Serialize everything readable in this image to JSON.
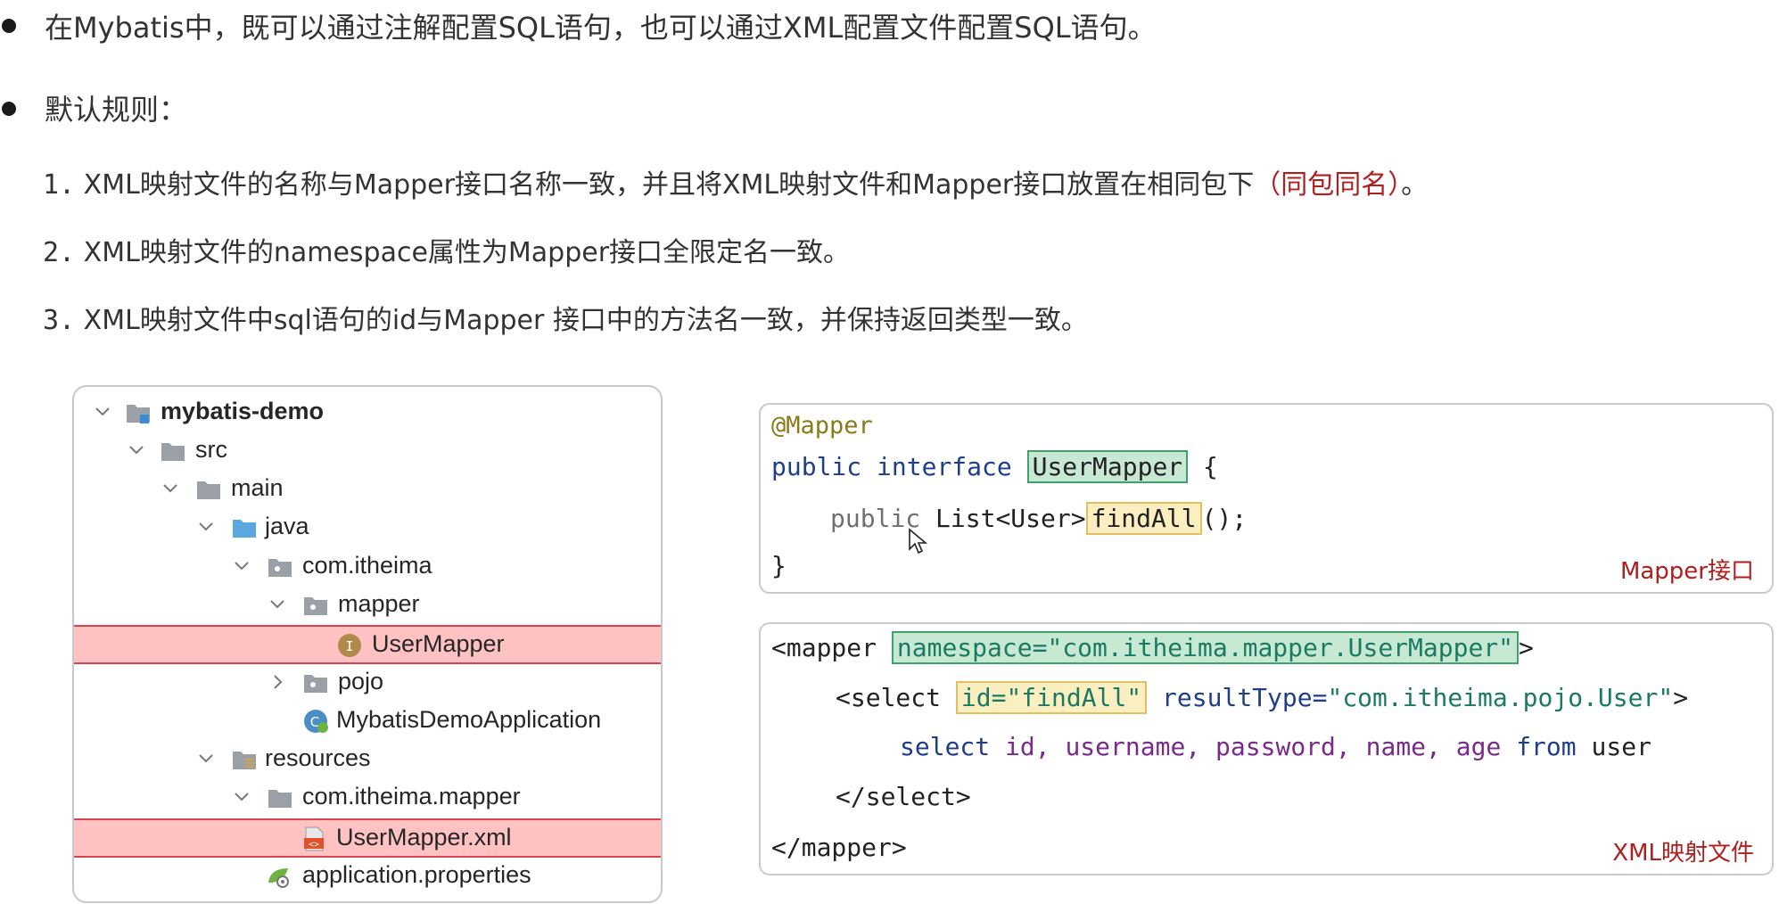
{
  "intro": {
    "line1": "在Mybatis中，既可以通过注解配置SQL语句，也可以通过XML配置文件配置SQL语句。",
    "line2": "默认规则："
  },
  "rules": [
    {
      "num": "1.",
      "text": "XML映射文件的名称与Mapper接口名称一致，并且将XML映射文件和Mapper接口放置在相同包下",
      "highlight": "（同包同名）",
      "tail": "。"
    },
    {
      "num": "2.",
      "text": "XML映射文件的namespace属性为Mapper接口全限定名一致。"
    },
    {
      "num": "3.",
      "text": "XML映射文件中sql语句的id与Mapper 接口中的方法名一致，并保持返回类型一致。"
    }
  ],
  "tree": {
    "items": [
      {
        "label": "mybatis-demo",
        "icon": "module-folder-icon"
      },
      {
        "label": "src",
        "icon": "folder-icon"
      },
      {
        "label": "main",
        "icon": "folder-icon"
      },
      {
        "label": "java",
        "icon": "source-folder-icon"
      },
      {
        "label": "com.itheima",
        "icon": "package-icon"
      },
      {
        "label": "mapper",
        "icon": "package-icon"
      },
      {
        "label": "UserMapper",
        "icon": "interface-icon"
      },
      {
        "label": "pojo",
        "icon": "package-icon"
      },
      {
        "label": "MybatisDemoApplication",
        "icon": "spring-class-icon"
      },
      {
        "label": "resources",
        "icon": "resources-folder-icon"
      },
      {
        "label": "com.itheima.mapper",
        "icon": "folder-icon"
      },
      {
        "label": "UserMapper.xml",
        "icon": "xml-file-icon"
      },
      {
        "label": "application.properties",
        "icon": "properties-file-icon"
      }
    ]
  },
  "java_code": {
    "annotation": "@Mapper",
    "kw_public": "public",
    "kw_interface": "interface",
    "interface_name": "UserMapper",
    "open_brace": "{",
    "method_public": "public",
    "return_type": "List<User>",
    "method_name": "findAll",
    "method_tail": "();",
    "close_brace": "}",
    "caption": "Mapper接口"
  },
  "xml_code": {
    "mapper_open": "<mapper",
    "namespace_attr": "namespace=\"com.itheima.mapper.UserMapper\"",
    "mapper_open_end": ">",
    "select_open": "<select",
    "id_attr": "id=\"findAll\"",
    "result_type_key": "resultType=",
    "result_type_val": "\"com.itheima.pojo.User\"",
    "select_open_end": ">",
    "sql_select": "select",
    "sql_id": "id,",
    "sql_username": "username,",
    "sql_password": "password,",
    "sql_name": "name,",
    "sql_age": "age",
    "sql_from": "from",
    "sql_user": "user",
    "select_close": "</select>",
    "mapper_close": "</mapper>",
    "caption": "XML映射文件"
  },
  "colors": {
    "highlight_red": "#ffc2c2",
    "caption_red": "#b01e1e",
    "green_box": "#c7e8d2",
    "yellow_box": "#fbeec0"
  }
}
